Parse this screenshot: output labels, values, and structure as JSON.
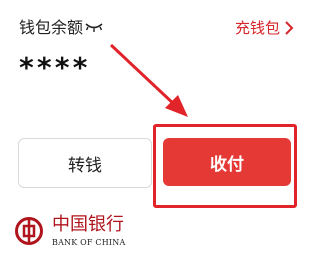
{
  "wallet": {
    "balance_label": "钱包余额",
    "balance_value": "****",
    "recharge_label": "充钱包",
    "visibility_icon": "eye-closed-icon",
    "chevron_icon": "chevron-right-icon"
  },
  "actions": {
    "transfer_label": "转钱",
    "collect_label": "收付"
  },
  "bank": {
    "logo_icon": "bank-of-china-logo",
    "name_cn": "中国银行",
    "name_en": "BANK OF CHINA"
  },
  "colors": {
    "accent": "#e53935",
    "annotation": "#e1232a",
    "bank_red": "#b0141d"
  }
}
